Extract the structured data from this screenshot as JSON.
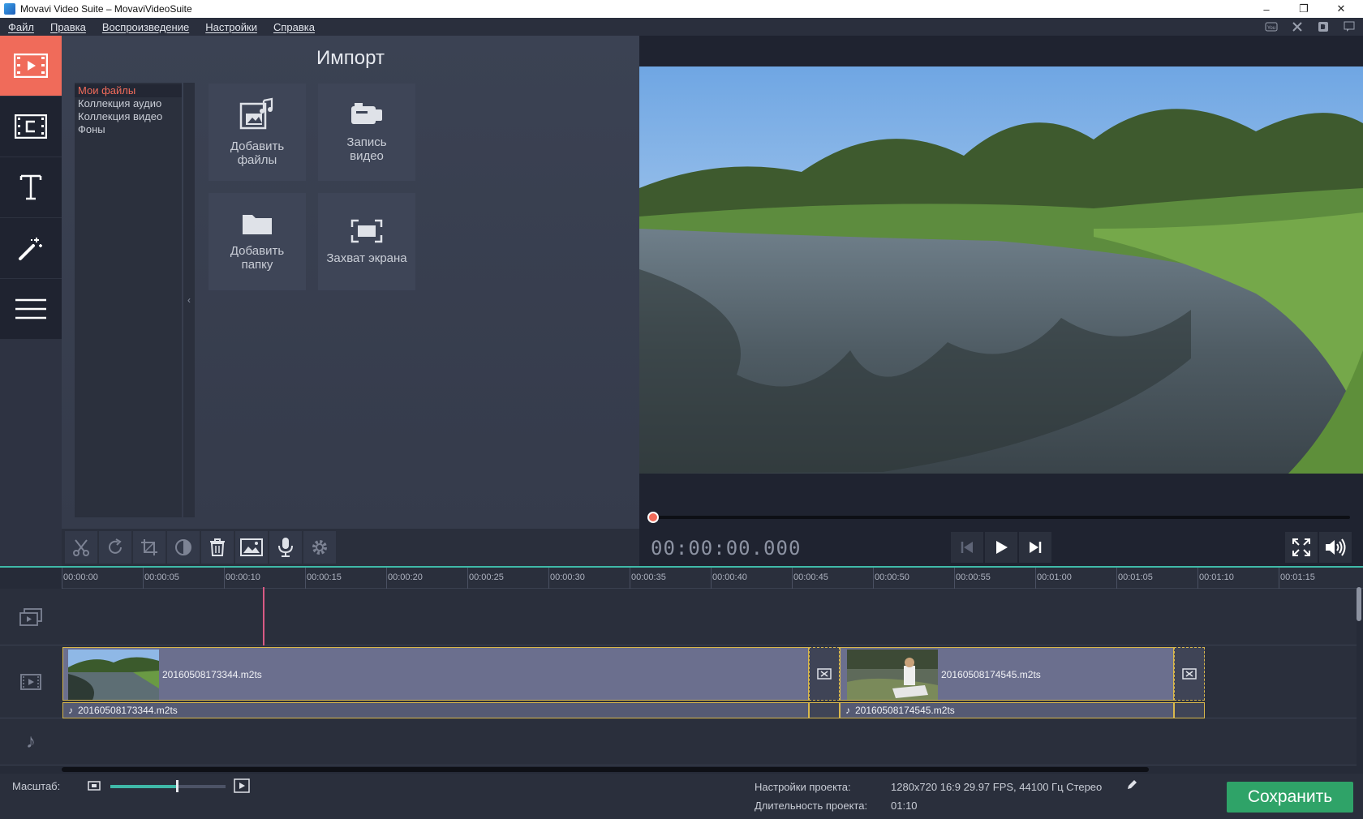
{
  "window": {
    "title": "Movavi Video Suite – MovaviVideoSuite",
    "controls": {
      "minimize": "–",
      "restore": "❐",
      "close": "✕"
    }
  },
  "menu": {
    "items": [
      "Файл",
      "Правка",
      "Воспроизведение",
      "Настройки",
      "Справка"
    ],
    "tray_icons": [
      "youtube-icon",
      "tools-icon",
      "vk-icon",
      "chat-icon"
    ]
  },
  "left_toolbar": {
    "tabs": [
      {
        "icon": "import-video-icon",
        "active": true
      },
      {
        "icon": "filters-icon",
        "active": false
      },
      {
        "icon": "titles-icon",
        "active": false
      },
      {
        "icon": "magic-wand-icon",
        "active": false
      },
      {
        "icon": "more-menu-icon",
        "active": false
      }
    ]
  },
  "import_panel": {
    "title": "Импорт",
    "categories": [
      "Мои файлы",
      "Коллекция аудио",
      "Коллекция видео",
      "Фоны"
    ],
    "selected_category": 0,
    "collapse_glyph": "‹",
    "tiles": [
      {
        "label_line1": "Добавить",
        "label_line2": "файлы",
        "icon": "add-files-icon"
      },
      {
        "label_line1": "Запись",
        "label_line2": "видео",
        "icon": "camera-icon"
      },
      {
        "label_line1": "Добавить",
        "label_line2": "папку",
        "icon": "folder-icon"
      },
      {
        "label_line1": "",
        "label_line2": "Захват экрана",
        "icon": "screen-capture-icon"
      }
    ]
  },
  "player": {
    "timecode": "00:00:00.000",
    "progress": 0.0,
    "accent": "#f06b5a"
  },
  "edit_toolbar": {
    "buttons": [
      "cut-icon",
      "rotate-icon",
      "crop-icon",
      "color-adjust-icon",
      "delete-icon",
      "image-icon",
      "microphone-icon",
      "settings-icon"
    ]
  },
  "timeline": {
    "ruler": [
      "00:00:00",
      "00:00:05",
      "00:00:10",
      "00:00:15",
      "00:00:20",
      "00:00:25",
      "00:00:30",
      "00:00:35",
      "00:00:40",
      "00:00:45",
      "00:00:50",
      "00:00:55",
      "00:01:00",
      "00:01:05",
      "00:01:10",
      "00:01:15"
    ],
    "video_clips": [
      {
        "name": "20160508173344.m2ts"
      },
      {
        "name": "20160508174545.m2ts"
      }
    ],
    "audio_clips": [
      {
        "name": "20160508173344.m2ts"
      },
      {
        "name": "20160508174545.m2ts"
      }
    ],
    "audio_glyph": "♪",
    "accent": "#3fb9a8"
  },
  "status": {
    "scale_label": "Масштаб:",
    "scale_level": 0.58,
    "project_settings_label": "Настройки проекта:",
    "project_settings_value": "1280x720 16:9 29.97 FPS, 44100 Гц Стерео",
    "duration_label": "Длительность проекта:",
    "duration_value": "01:10",
    "save_label": "Сохранить",
    "save_color": "#2fa368"
  }
}
